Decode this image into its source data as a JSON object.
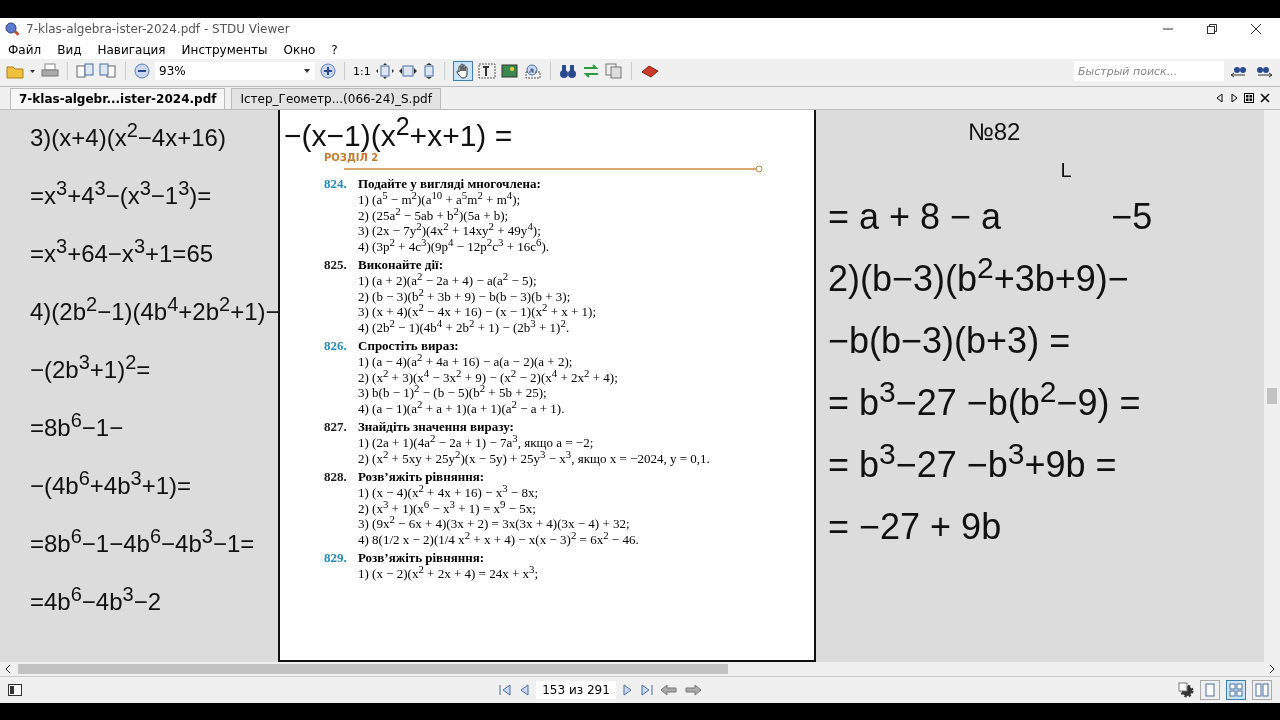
{
  "window": {
    "title": "7-klas-algebra-ister-2024.pdf - STDU Viewer"
  },
  "menu": [
    "Файл",
    "Вид",
    "Навигация",
    "Инструменты",
    "Окно",
    "?"
  ],
  "toolbar": {
    "zoom": "93%",
    "actual_size": "1:1",
    "pan_tool_active": true,
    "search_placeholder": "Быстрый поиск..."
  },
  "tabs": [
    {
      "label": "7-klas-algebr...ister-2024.pdf",
      "selected": true
    },
    {
      "label": "Істер_Геометр...(066-24)_S.pdf",
      "selected": false
    }
  ],
  "left_ink": [
    "3)(x+4)(x$^{2}$−4x+16)",
    "=x$^{3}$+4$^{3}$−(x$^{3}$−1$^{3}$)=",
    "=x$^{3}$+64−x$^{3}$+1=65",
    "4)(2b$^{2}$−1)(4b$^{4}$+2b$^{2}$+1)−",
    "−(2b$^{3}$+1)$^{2}$=",
    "=8b$^{6}$−1−",
    "−(4b$^{6}$+4b$^{3}$+1)=",
    "=8b$^{6}$−1−4b$^{6}$−4b$^{3}$−1=",
    "=4b$^{6}$−4b$^{3}$−2"
  ],
  "page": {
    "ink": "−(x−1)(x$^{2}$+x+1) =",
    "section": "РОЗДІЛ 2",
    "exercises": [
      {
        "number": "824.",
        "color": "#2a8ab8",
        "title": "Подайте у вигляді многочлена:",
        "items": [
          "1) (a$^{5}$ − m$^{2}$)(a$^{10}$ + a$^{5}$m$^{2}$ + m$^{4}$);",
          "2) (25a$^{2}$ − 5ab + b$^{2}$)(5a + b);",
          "3) (2x − 7y$^{2}$)(4x$^{2}$ + 14xy$^{2}$ + 49y$^{4}$);",
          "4) (3p$^{2}$ + 4c$^{3}$)(9p$^{4}$ − 12p$^{2}$c$^{3}$ + 16c$^{6}$)."
        ]
      },
      {
        "number": "825.",
        "color": "#1a1a1a",
        "title": "Виконайте дії:",
        "items": [
          "1) (a + 2)(a$^{2}$ − 2a + 4) − a(a$^{2}$ − 5);",
          "2) (b − 3)(b$^{2}$ + 3b + 9) − b(b − 3)(b + 3);",
          "3) (x + 4)(x$^{2}$ − 4x + 16) − (x − 1)(x$^{2}$ + x + 1);",
          "4) (2b$^{2}$ − 1)(4b$^{4}$ + 2b$^{2}$ + 1) − (2b$^{3}$ + 1)$^{2}$."
        ]
      },
      {
        "number": "826.",
        "color": "#2a8ab8",
        "title": "Спростіть вираз:",
        "items": [
          "1) (a − 4)(a$^{2}$ + 4a + 16) − a(a − 2)(a + 2);",
          "2) (x$^{2}$ + 3)(x$^{4}$ − 3x$^{2}$ + 9) − (x$^{2}$ − 2)(x$^{4}$ + 2x$^{2}$ + 4);",
          "3) b(b − 1)$^{2}$ − (b − 5)(b$^{2}$ + 5b + 25);",
          "4) (a − 1)(a$^{2}$ + a + 1)(a + 1)(a$^{2}$ − a + 1)."
        ]
      },
      {
        "number": "827.",
        "color": "#1a1a1a",
        "title": "Знайдіть значення виразу:",
        "items": [
          "1) (2a + 1)(4a$^{2}$ − 2a + 1) − 7a$^{3}$, якщо a = −2;",
          "2) (x$^{2}$ + 5xy + 25y$^{2}$)(x − 5y) + 25y$^{3}$ − x$^{3}$, якщо x = −2024, y = 0,1."
        ]
      },
      {
        "number": "828.",
        "color": "#1a1a1a",
        "title": "Розв’яжіть рівняння:",
        "items": [
          "1) (x − 4)(x$^{2}$ + 4x + 16) − x$^{3}$ − 8x;",
          "2) (x$^{3}$ + 1)(x$^{6}$ − x$^{3}$ + 1) = x$^{9}$ − 5x;",
          "3) (9x$^{2}$ − 6x + 4)(3x + 2) = 3x(3x + 4)(3x − 4) + 32;",
          "4) 8(1/2 x − 2)(1/4 x$^{2}$ + x + 4) − x(x − 3)$^{2}$ = 6x$^{2}$ − 46."
        ]
      },
      {
        "number": "829.",
        "color": "#2a8ab8",
        "title": "Розв’яжіть рівняння:",
        "items": [
          "1) (x − 2)(x$^{2}$ + 2x + 4) = 24x + x$^{3}$;"
        ]
      }
    ]
  },
  "right_ink": {
    "heading": "№82",
    "mark": "L",
    "lines": [
      {
        "parts": [
          "= a + 8 − a",
          "−5"
        ]
      },
      {
        "parts": [
          "2)(b−3)(b$^{2}$+3b+9)−"
        ]
      },
      {
        "parts": [
          "−b(b−3)(b+3) ="
        ]
      },
      {
        "parts": [
          "= b$^{3}$−27 −b(b$^{2}$−9) ="
        ]
      },
      {
        "parts": [
          "= b$^{3}$−27 −b$^{3}$+9b ="
        ]
      },
      {
        "parts": [
          "= −27 + 9b"
        ]
      }
    ]
  },
  "status_bar": {
    "page": "153 из 291",
    "view_modes": [
      {
        "selected": false
      },
      {
        "selected": true
      },
      {
        "selected": false
      }
    ]
  }
}
